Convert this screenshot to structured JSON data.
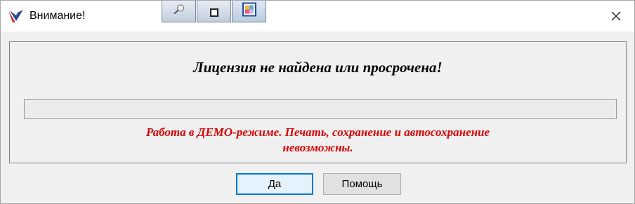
{
  "window": {
    "title": "Внимание!",
    "close_label": "×"
  },
  "dialog": {
    "headline": "Лицензия не найдена или просрочена!",
    "progress": 0,
    "demo_line1": "Работа в ДЕМО-режиме. Печать, сохранение и автосохранение",
    "demo_line2": "невозможны."
  },
  "buttons": {
    "ok_label": "Да",
    "help_label": "Помощь"
  },
  "icons": {
    "app": "app-logo-icon",
    "tb1": "pin-icon",
    "tb2": "stop-icon",
    "tb3": "image-icon",
    "close": "close-icon"
  },
  "colors": {
    "warning_text": "#e00000",
    "accent": "#0078d7"
  }
}
